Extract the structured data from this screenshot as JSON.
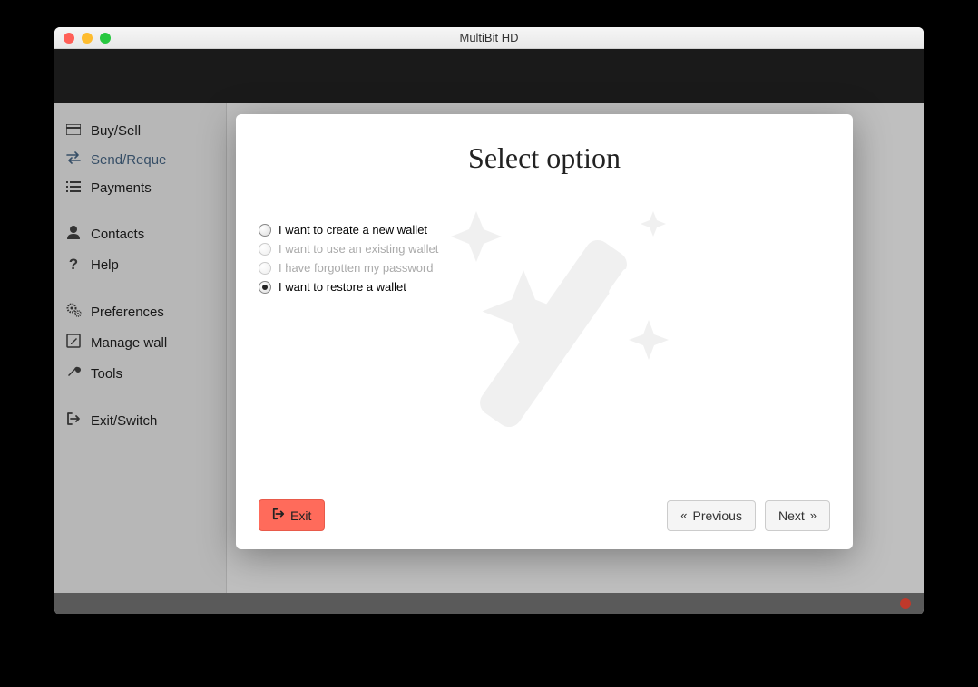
{
  "window": {
    "title": "MultiBit HD"
  },
  "sidebar": {
    "items": [
      {
        "label": "Buy/Sell"
      },
      {
        "label": "Send/Reque"
      },
      {
        "label": "Payments"
      },
      {
        "label": "Contacts"
      },
      {
        "label": "Help"
      },
      {
        "label": "Preferences"
      },
      {
        "label": "Manage wall"
      },
      {
        "label": "Tools"
      },
      {
        "label": "Exit/Switch"
      }
    ]
  },
  "modal": {
    "title": "Select option",
    "options": [
      {
        "label": "I want to create a new wallet",
        "enabled": true,
        "selected": false
      },
      {
        "label": "I want to use an existing wallet",
        "enabled": false,
        "selected": false
      },
      {
        "label": "I have forgotten my password",
        "enabled": false,
        "selected": false
      },
      {
        "label": "I want to restore a wallet",
        "enabled": true,
        "selected": true
      }
    ],
    "buttons": {
      "exit": "Exit",
      "previous": "Previous",
      "next": "Next"
    }
  }
}
